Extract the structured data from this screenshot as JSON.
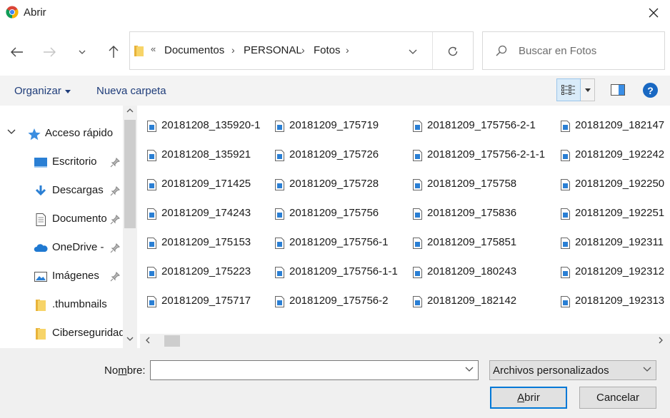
{
  "window": {
    "title": "Abrir"
  },
  "address": {
    "overflow_glyph": "«",
    "crumbs": [
      "Documentos",
      "PERSONAL",
      "Fotos"
    ],
    "separator": "›"
  },
  "search": {
    "placeholder": "Buscar en Fotos"
  },
  "toolbar": {
    "organize_label": "Organizar",
    "new_folder_label": "Nueva carpeta",
    "help_label": "?"
  },
  "sidebar": {
    "items": [
      {
        "label": "Acceso rápido",
        "icon": "star-icon",
        "expanded": true
      },
      {
        "label": "Escritorio",
        "icon": "desktop-icon",
        "pinned": true
      },
      {
        "label": "Descargas",
        "icon": "download-icon",
        "pinned": true
      },
      {
        "label": "Documento",
        "icon": "document-icon",
        "pinned": true
      },
      {
        "label": "OneDrive - ",
        "icon": "cloud-icon",
        "pinned": true
      },
      {
        "label": "Imágenes",
        "icon": "pictures-icon",
        "pinned": true
      },
      {
        "label": ".thumbnails",
        "icon": "folder-icon"
      },
      {
        "label": "Ciberseguridad",
        "icon": "folder-icon"
      }
    ]
  },
  "files": {
    "columns": [
      [
        "20181208_135920-1",
        "20181208_135921",
        "20181209_171425",
        "20181209_174243",
        "20181209_175153",
        "20181209_175223",
        "20181209_175717"
      ],
      [
        "20181209_175719",
        "20181209_175726",
        "20181209_175728",
        "20181209_175756",
        "20181209_175756-1",
        "20181209_175756-1-1",
        "20181209_175756-2"
      ],
      [
        "20181209_175756-2-1",
        "20181209_175756-2-1-1",
        "20181209_175758",
        "20181209_175836",
        "20181209_175851",
        "20181209_180243",
        "20181209_182142"
      ],
      [
        "20181209_182147",
        "20181209_192242",
        "20181209_192250",
        "20181209_192251",
        "20181209_192311",
        "20181209_192312",
        "20181209_192313"
      ]
    ]
  },
  "footer": {
    "name_label_pre": "No",
    "name_label_accel": "m",
    "name_label_post": "bre:",
    "name_value": "",
    "filter_value": "Archivos personalizados",
    "open_label_accel": "A",
    "open_label_rest": "brir",
    "cancel_label": "Cancelar"
  },
  "colors": {
    "accent": "#0078d7",
    "link": "#1f3d7a",
    "help": "#1968c2"
  }
}
